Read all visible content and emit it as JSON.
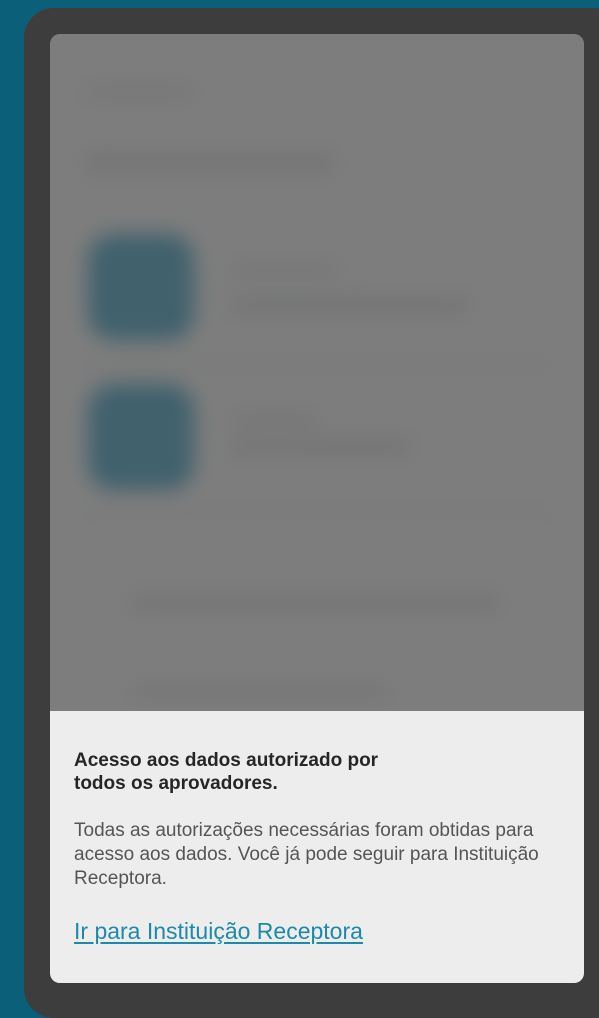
{
  "modal": {
    "title": "Acesso aos dados autorizado por todos os aprovadores.",
    "body": "Todas as autorizações necessárias foram obtidas para acesso aos dados. Você já pode seguir para Instituição Receptora.",
    "link": "Ir para Instituição Receptora"
  },
  "colors": {
    "background": "#0b5f78",
    "device_frame": "#3d3d3d",
    "sheet": "#ededed",
    "link": "#1c8aa8",
    "tile": "#1f5163"
  }
}
